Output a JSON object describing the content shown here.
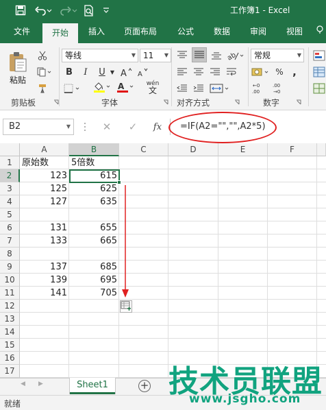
{
  "window": {
    "doc_title": "工作簿1  -  Excel"
  },
  "ribbon_tabs": [
    {
      "label": "文件"
    },
    {
      "label": "开始"
    },
    {
      "label": "插入"
    },
    {
      "label": "页面布局"
    },
    {
      "label": "公式"
    },
    {
      "label": "数据"
    },
    {
      "label": "审阅"
    },
    {
      "label": "视图"
    }
  ],
  "active_tab": "开始",
  "ribbon": {
    "clipboard": {
      "paste_label": "粘贴",
      "group_label": "剪贴板"
    },
    "font": {
      "name": "等线",
      "size": "11",
      "group_label": "字体",
      "bold": "B",
      "italic": "I",
      "underline": "U",
      "phonetic": "wén"
    },
    "alignment": {
      "group_label": "对齐方式"
    },
    "number": {
      "format": "常规",
      "group_label": "数字"
    }
  },
  "formula_bar": {
    "name_box": "B2",
    "fx_label": "fx",
    "formula": "=IF(A2=\"\",\"\",A2*5)"
  },
  "grid": {
    "columns": [
      "A",
      "B",
      "C",
      "D",
      "E",
      "F"
    ],
    "selected_column": "B",
    "rows": [
      "1",
      "2",
      "3",
      "4",
      "5",
      "6",
      "7",
      "8",
      "9",
      "10",
      "11",
      "12",
      "13",
      "14",
      "15",
      "16",
      "17"
    ],
    "selected_row": "2",
    "cells": {
      "A1": "原始数",
      "B1": "5倍数",
      "A2": "123",
      "B2": "615",
      "A3": "125",
      "B3": "625",
      "A4": "127",
      "B4": "635",
      "A6": "131",
      "B6": "655",
      "A7": "133",
      "B7": "665",
      "A9": "137",
      "B9": "685",
      "A10": "139",
      "B10": "695",
      "A11": "141",
      "B11": "705"
    }
  },
  "sheets": [
    {
      "name": "Sheet1"
    }
  ],
  "status": {
    "text": "就绪"
  },
  "watermark": {
    "title": "技术员联盟",
    "url": "www.jsgho.com"
  },
  "colors": {
    "accent": "#217346",
    "annotation": "#e02020",
    "watermark": "#11a37f"
  }
}
